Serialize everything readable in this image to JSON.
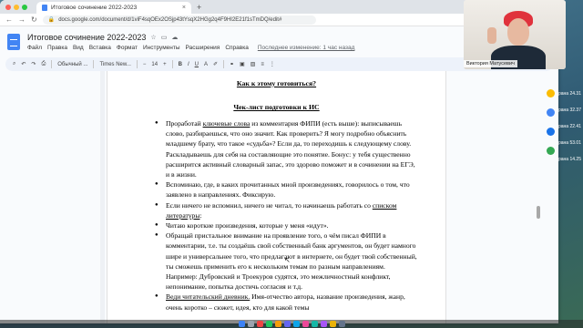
{
  "browser": {
    "tab_title": "Итоговое сочинение 2022-2023",
    "tab_close": "×",
    "new_tab": "+",
    "url": "docs.google.com/document/d/1viF4sqOEx2OSjp43tYsqX2HGg2q4F9HI2E21f1sTmDQ/edit#"
  },
  "docs": {
    "title": "Итоговое сочинение 2022-2023",
    "menu": [
      "Файл",
      "Правка",
      "Вид",
      "Вставка",
      "Формат",
      "Инструменты",
      "Расширения",
      "Справка"
    ],
    "last_edit": "Последнее изменение: 1 час назад",
    "toolbar": {
      "style": "Обычный ...",
      "font": "Times New...",
      "size": "14",
      "minus": "−",
      "plus": "+"
    }
  },
  "document": {
    "heading1": "Как к этому готовиться?",
    "heading2": "Чек-лист подготовки к ИС",
    "items": [
      {
        "pre": "Проработай ",
        "u": "ключевые слова",
        "post": " из комментария ФИПИ (есть выше): выписываешь слово, разбираешься, что оно значит. Как проверить? Я могу подробно объяснить младшему брату, что такое «судьба»? Если да, то переходишь к следующему слову. Раскладываешь для себя на составляющие это понятие. Бонус: у тебя существенно расширится активный словарный запас, это здорово поможет и в сочинении на ЕГЭ, и в жизни."
      },
      {
        "pre": "Вспоминаю, где, в каких прочитанных мной произведениях, говорилось о том, что заявлено в направлениях. Фиксирую.",
        "u": "",
        "post": ""
      },
      {
        "pre": "Если ничего не вспомнил, ничего не читал, то начинаешь работать со ",
        "u": "списком литературы",
        "post": ":"
      },
      {
        "pre": "Читаю короткие произведения, которые у меня «идут».",
        "u": "",
        "post": ""
      },
      {
        "pre": "Обращай пристальное внимание на проявление того, о чём писал ФИПИ в комментарии, т.е. ты создаёшь свой собственный банк аргументов, он будет намного шире и универсальнее того, что предлагают в интернете, он будет твой собственный, ты сможешь применить его к нескольким темам по разным направлениям. Например: Дубровский и Троекуров судятся, это межличностный конфликт, непонимание, попытка достичь согласия и т.д.",
        "u": "",
        "post": ""
      },
      {
        "pre": "",
        "u": "Веди читательский дневник.",
        "post": " Имя-отчество автора, название произведения, жанр, очень коротко – сюжет, идея, кто для какой темы"
      }
    ]
  },
  "webcam": {
    "name": "Виктория Матусевич"
  },
  "desktop": {
    "labels": [
      "рана 24.31",
      "рана 32.37",
      "рана 22.41",
      "рана 53.01",
      "рана 14.25"
    ]
  },
  "colors": {
    "docs_blue": "#4285f4",
    "toolbar_bg": "#edf2fa"
  }
}
